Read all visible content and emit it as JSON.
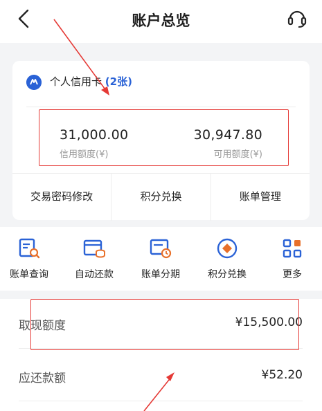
{
  "header": {
    "title": "账户总览",
    "back_icon": "chevron-left-icon",
    "service_icon": "headset-icon"
  },
  "card": {
    "title": "个人信用卡",
    "count": "(2张)",
    "logo_icon": "card-brand-icon",
    "credit_limit": {
      "value": "31,000.00",
      "label": "信用额度(¥)"
    },
    "available_limit": {
      "value": "30,947.80",
      "label": "可用额度(¥)"
    },
    "actions": [
      {
        "label": "交易密码修改"
      },
      {
        "label": "积分兑换"
      },
      {
        "label": "账单管理"
      }
    ]
  },
  "quick_actions": [
    {
      "label": "账单查询",
      "icon": "bill-search-icon"
    },
    {
      "label": "自动还款",
      "icon": "auto-repay-icon"
    },
    {
      "label": "账单分期",
      "icon": "installment-icon"
    },
    {
      "label": "积分兑换",
      "icon": "points-icon"
    },
    {
      "label": "更多",
      "icon": "grid-icon"
    }
  ],
  "summary": [
    {
      "label": "取现额度",
      "value": "¥15,500.00"
    },
    {
      "label": "应还款额",
      "value": "¥52.20"
    }
  ],
  "colors": {
    "accent": "#2a62d6",
    "annotation": "#e53935",
    "background": "#f3f4f6"
  }
}
